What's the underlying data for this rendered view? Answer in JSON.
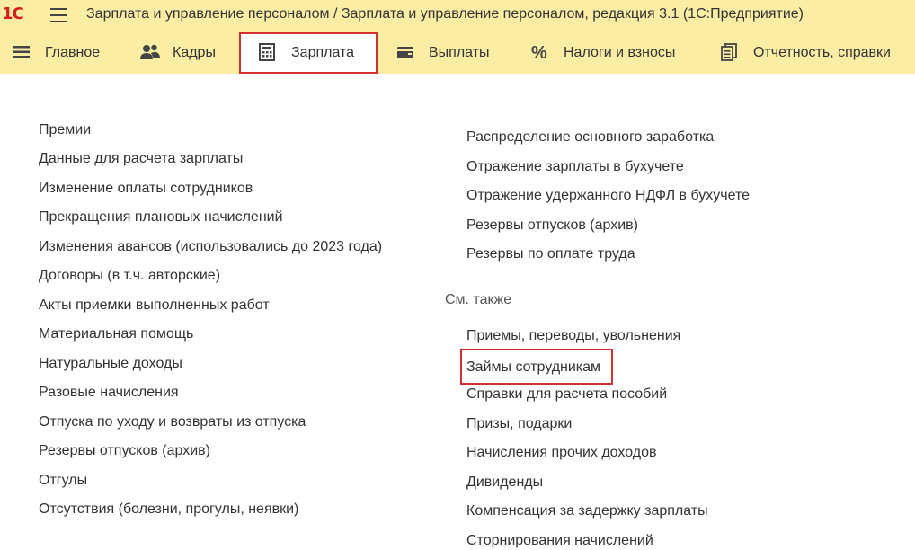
{
  "app": {
    "logo": "1С",
    "title": "Зарплата и управление персоналом / Зарплата и управление персоналом, редакция 3.1  (1С:Предприятие)"
  },
  "sections": [
    {
      "label": "Главное",
      "icon": "hamburger-list-icon"
    },
    {
      "label": "Кадры",
      "icon": "people-icon"
    },
    {
      "label": "Зарплата",
      "icon": "calculator-icon",
      "active": true
    },
    {
      "label": "Выплаты",
      "icon": "wallet-icon"
    },
    {
      "label": "Налоги и взносы",
      "icon": "percent-icon"
    },
    {
      "label": "Отчетность, справки",
      "icon": "documents-icon"
    }
  ],
  "left_links": [
    "Премии",
    "Данные для расчета зарплаты",
    "Изменение оплаты сотрудников",
    "Прекращения плановых начислений",
    "Изменения авансов (использовались до 2023 года)",
    "Договоры (в т.ч. авторские)",
    "Акты приемки выполненных работ",
    "Материальная помощь",
    "Натуральные доходы",
    "Разовые начисления",
    "Отпуска по уходу и возвраты из отпуска",
    "Резервы отпусков (архив)",
    "Отгулы",
    "Отсутствия (болезни, прогулы, неявки)"
  ],
  "right_links": [
    "Распределение основного заработка",
    "Отражение зарплаты в бухучете",
    "Отражение удержанного НДФЛ в бухучете",
    "Резервы отпусков (архив)",
    "Резервы по оплате труда"
  ],
  "see_also": {
    "header": "См. также",
    "items": [
      "Приемы, переводы, увольнения",
      "Займы сотрудникам",
      "Справки для расчета пособий",
      "Призы, подарки",
      "Начисления прочих доходов",
      "Дивиденды",
      "Компенсация за задержку зарплаты",
      "Сторнирования начислений"
    ]
  }
}
